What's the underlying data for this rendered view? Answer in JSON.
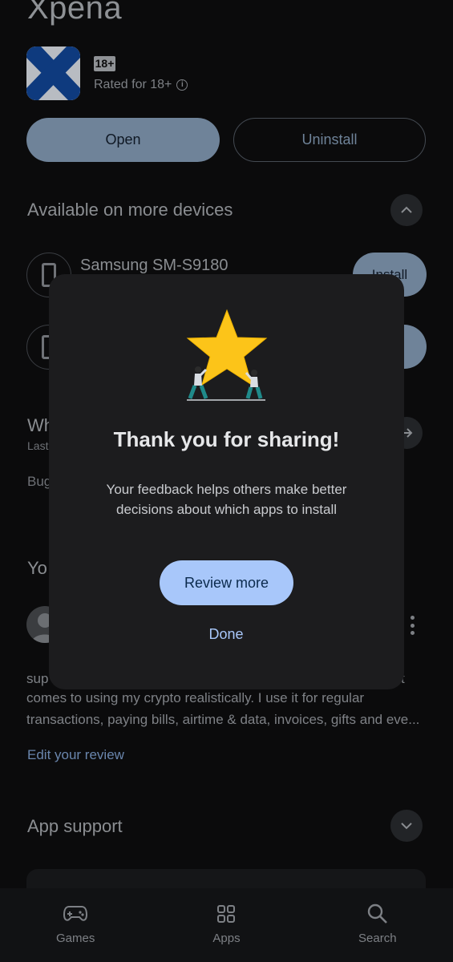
{
  "app": {
    "name": "Xpena",
    "age_badge": "18+",
    "rated_text": "Rated for 18+"
  },
  "actions": {
    "open_label": "Open",
    "uninstall_label": "Uninstall"
  },
  "more_devices": {
    "title": "Available on more devices",
    "devices": [
      {
        "name": "Samsung SM-S9180",
        "install_label": "Install"
      }
    ]
  },
  "behind_fragments": {
    "whats_new_head": "Wh",
    "whats_new_sub": "Last",
    "bug_text": "Bug",
    "your_review_head": "Yo",
    "review_line1_start": "sup",
    "review_line1_end": "t"
  },
  "review": {
    "line2": "comes to using my crypto realistically. I use it for regular",
    "line3": "transactions, paying bills, airtime & data, invoices, gifts and eve...",
    "edit_label": "Edit your review"
  },
  "app_support": {
    "title": "App support"
  },
  "dialog": {
    "title": "Thank you for sharing!",
    "body": "Your feedback helps others make better decisions about which apps to install",
    "primary_label": "Review more",
    "secondary_label": "Done"
  },
  "bottom_nav": {
    "items": [
      {
        "label": "Games",
        "icon": "gamepad-icon"
      },
      {
        "label": "Apps",
        "icon": "apps-grid-icon"
      },
      {
        "label": "Search",
        "icon": "search-icon"
      }
    ]
  },
  "colors": {
    "accent": "#a8c7fa",
    "dialog_bg": "#1c1c1e",
    "star": "#fcc419"
  }
}
